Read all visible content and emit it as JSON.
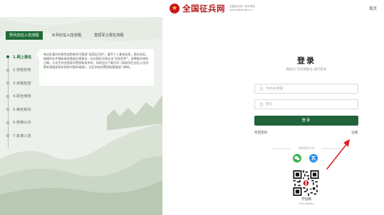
{
  "header": {
    "emblem_glyph": "★",
    "site_title": "全国征兵网",
    "site_sub_line1": "全国征兵唯一官方网站",
    "site_sub_line2": "www.gfbzb.gov.cn",
    "home_link": "首页"
  },
  "tabs": [
    {
      "label": "男兵应征入伍流程",
      "active": true
    },
    {
      "label": "女兵应征入伍流程",
      "active": false
    },
    {
      "label": "直招军士报名流程",
      "active": false
    }
  ],
  "steps": [
    {
      "label": "1.网上报名",
      "active": true
    },
    {
      "label": "2.初检初考",
      "active": false
    },
    {
      "label": "3.体格检查",
      "active": false
    },
    {
      "label": "4.政治考核",
      "active": false
    },
    {
      "label": "5.审定新兵",
      "active": false
    },
    {
      "label": "6.张榜公示",
      "active": false
    },
    {
      "label": "7.批准入伍",
      "active": false
    }
  ],
  "step_description": "有应征意向的男性适龄青年可登录\"全国征兵网\"，填写个人基本信息，报名应征。根据所在乡镇街道武装部反馈意见，在全国征兵网点击\"初检初考\"，选择报名体检日期。大学生符合国家学费资助条件的，同时还应下载打印《高校学生应征入伍学费补偿国家助学贷款代偿申请表》，交至学校学费资助管理部门审核。",
  "login": {
    "title": "登录",
    "subtitle": "微信扫 学信网账号 进行登录",
    "account_placeholder": "手机号/邮箱",
    "password_placeholder": "密码",
    "login_button": "登录",
    "forgot_password": "找回密码",
    "register": "注册",
    "other_login_text": "其他登录方式",
    "wechat_icon": "wechat-icon",
    "alt_icon": "alt-login-icon",
    "qr_label": "学信网",
    "qr_sublabel": "chsi_zhaosu"
  },
  "colors": {
    "brand_green": "#20633a",
    "brand_red": "#c8161d",
    "annotation_red": "#e02020",
    "panel_bg": "#edf1ec"
  }
}
